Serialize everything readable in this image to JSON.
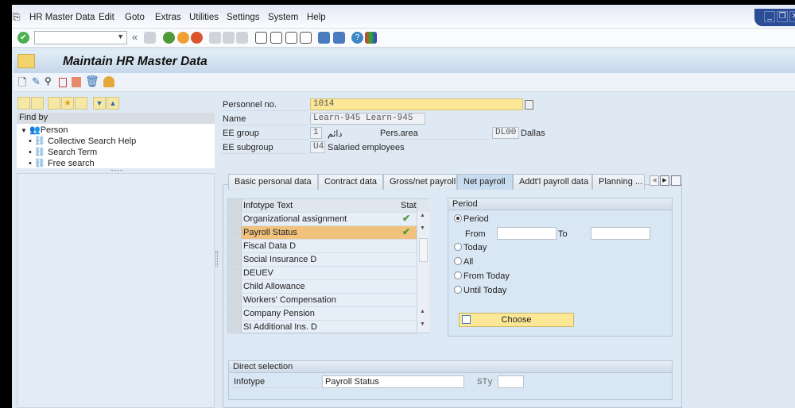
{
  "menu": [
    "HR Master Data",
    "Edit",
    "Goto",
    "Extras",
    "Utilities",
    "Settings",
    "System",
    "Help"
  ],
  "title": "Maintain HR Master Data",
  "find": {
    "header": "Find by",
    "root": "Person",
    "items": [
      "Collective Search Help",
      "Search Term",
      "Free search"
    ]
  },
  "header": {
    "personnel_label": "Personnel no.",
    "personnel_value": "1014",
    "name_label": "Name",
    "name_value": "Learn-945 Learn-945",
    "ee_group_label": "EE group",
    "ee_group_code": "1",
    "ee_group_text": "دائم",
    "pers_area_label": "Pers.area",
    "pers_area_code": "DL00",
    "pers_area_text": "Dallas",
    "ee_subgroup_label": "EE subgroup",
    "ee_subgroup_code": "U4",
    "ee_subgroup_text": "Salaried employees"
  },
  "tabs": [
    "Basic personal data",
    "Contract data",
    "Gross/net payroll",
    "Net payroll",
    "Addt'l payroll data",
    "Planning ..."
  ],
  "active_tab": "Net payroll",
  "table": {
    "col_text": "Infotype Text",
    "col_status": "Status",
    "rows": [
      {
        "text": "Organizational assignment",
        "status": "✔"
      },
      {
        "text": "Payroll Status",
        "status": "✔"
      },
      {
        "text": "Fiscal Data  D",
        "status": ""
      },
      {
        "text": "Social Insurance  D",
        "status": ""
      },
      {
        "text": "DEUEV",
        "status": ""
      },
      {
        "text": "Child Allowance",
        "status": ""
      },
      {
        "text": "Workers' Compensation",
        "status": ""
      },
      {
        "text": "Company Pension",
        "status": ""
      },
      {
        "text": "SI Additional Ins.  D",
        "status": ""
      }
    ]
  },
  "period": {
    "title": "Period",
    "options": [
      "Period",
      "Today",
      "All",
      "From Today",
      "Until Today"
    ],
    "selected": "Period",
    "from_label": "From",
    "from_value": "",
    "to_label": "To",
    "to_value": "",
    "choose_label": "Choose"
  },
  "direct": {
    "title": "Direct selection",
    "infotype_label": "Infotype",
    "infotype_value": "Payroll Status",
    "sty_label": "STy",
    "sty_value": ""
  },
  "colors": {
    "highlight": "#f1c27d",
    "required": "#fbe796",
    "accent": "#2b4d96"
  }
}
